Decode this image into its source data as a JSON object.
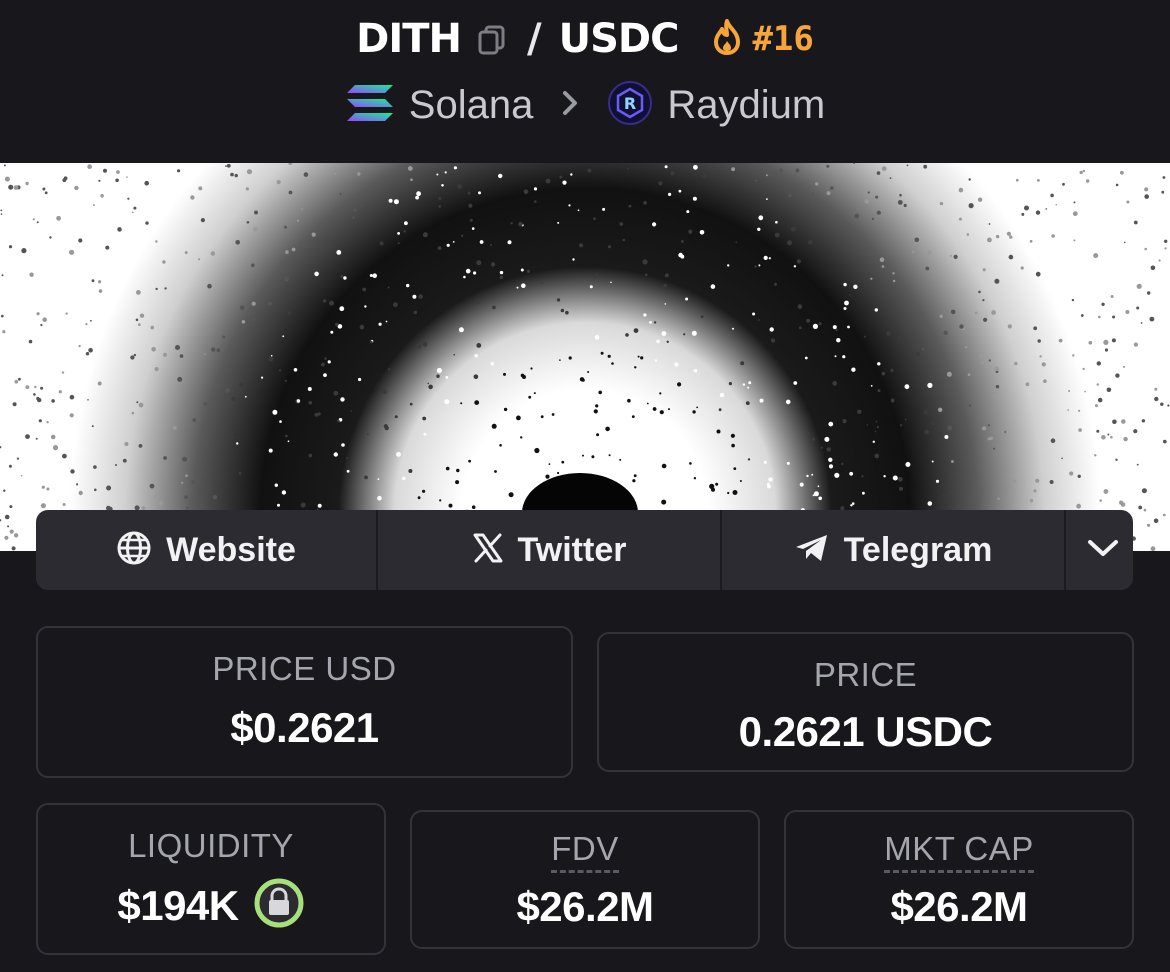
{
  "pair": {
    "base": "DITH",
    "separator": "/",
    "quote": "USDC",
    "rank": "#16"
  },
  "chain": {
    "name": "Solana",
    "dex": "Raydium"
  },
  "links": [
    {
      "label": "Website",
      "icon": "globe-icon"
    },
    {
      "label": "Twitter",
      "icon": "x-icon"
    },
    {
      "label": "Telegram",
      "icon": "telegram-icon"
    }
  ],
  "stats": {
    "price_usd": {
      "label": "PRICE USD",
      "value": "$0.2621"
    },
    "price": {
      "label": "PRICE",
      "value": "0.2621 USDC"
    },
    "liquidity": {
      "label": "LIQUIDITY",
      "value": "$194K"
    },
    "fdv": {
      "label": "FDV",
      "value": "$26.2M"
    },
    "mkt_cap": {
      "label": "MKT CAP",
      "value": "$26.2M"
    }
  },
  "colors": {
    "background": "#17171c",
    "rank_accent": "#f7a53b",
    "lock_ring": "#a6e07a",
    "card_border": "#33333a"
  }
}
